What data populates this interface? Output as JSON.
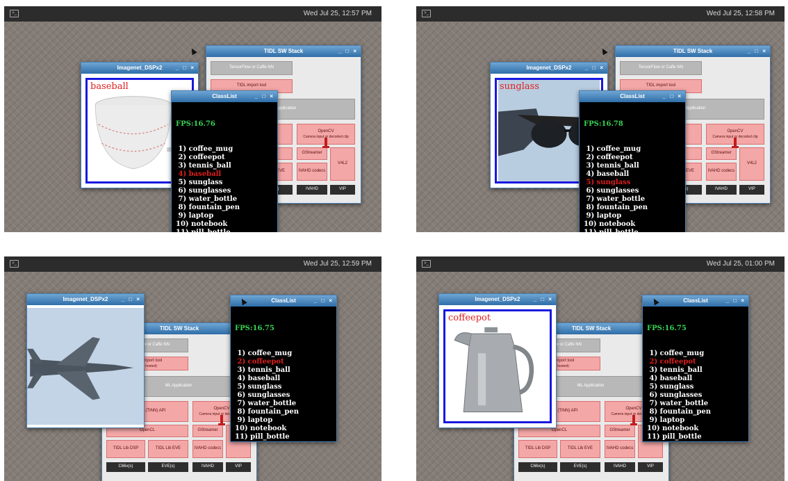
{
  "common": {
    "image_window_title": "Imagenet_DSPx2",
    "stack_window_title": "TIDL SW Stack",
    "classlist_title": "ClassList",
    "window_buttons": "_ □ ×",
    "stack_blocks": {
      "tensorflow": "TensorFlow or Caffe NN",
      "import_tool": "TIDL import tool",
      "import_tool_sub": "(x86 hosted)",
      "ml_application": "ML Application",
      "network": "Network (TINN) API",
      "opencv": "OpenCV",
      "opencv_sub": "Camera input or decoded clip",
      "opencl": "OpenCL",
      "gstreamer": "GStreamer",
      "lib_dsp": "TIDL Lib DSP",
      "lib_eve": "TIDL Lib EVE",
      "ivahd_codecs": "IVAHD codecs",
      "v4l2": "V4L2",
      "c66": "C66x(s)",
      "eve": "EVE(s)",
      "ivahd": "IVAHD",
      "vip": "VIP"
    }
  },
  "panels": [
    {
      "clock": "Wed Jul 25, 12:57 PM",
      "image_label": "baseball",
      "classlist_fps": "FPS:16.76",
      "classes": [
        {
          "num": "1)",
          "name": "coffee_mug"
        },
        {
          "num": "2)",
          "name": "coffeepot"
        },
        {
          "num": "3)",
          "name": "tennis_ball"
        },
        {
          "num": "4)",
          "name": "baseball"
        },
        {
          "num": "5)",
          "name": "sunglass"
        },
        {
          "num": "6)",
          "name": "sunglasses"
        },
        {
          "num": "7)",
          "name": "water_bottle"
        },
        {
          "num": "8)",
          "name": "fountain_pen"
        },
        {
          "num": "9)",
          "name": "laptop"
        },
        {
          "num": "10)",
          "name": "notebook"
        },
        {
          "num": "11)",
          "name": "pill_bottle"
        }
      ],
      "highlight_index": 3
    },
    {
      "clock": "Wed Jul 25, 12:58 PM",
      "image_label": "sunglass",
      "classlist_fps": "FPS:16.78",
      "classes": [
        {
          "num": "1)",
          "name": "coffee_mug"
        },
        {
          "num": "2)",
          "name": "coffeepot"
        },
        {
          "num": "3)",
          "name": "tennis_ball"
        },
        {
          "num": "4)",
          "name": "baseball"
        },
        {
          "num": "5)",
          "name": "sunglass"
        },
        {
          "num": "6)",
          "name": "sunglasses"
        },
        {
          "num": "7)",
          "name": "water_bottle"
        },
        {
          "num": "8)",
          "name": "fountain_pen"
        },
        {
          "num": "9)",
          "name": "laptop"
        },
        {
          "num": "10)",
          "name": "notebook"
        },
        {
          "num": "11)",
          "name": "pill_bottle"
        }
      ],
      "highlight_index": 4
    },
    {
      "clock": "Wed Jul 25, 12:59 PM",
      "image_label": "",
      "classlist_fps": "FPS:16.75",
      "classes": [
        {
          "num": "1)",
          "name": "coffee_mug"
        },
        {
          "num": "2)",
          "name": "coffeepot"
        },
        {
          "num": "3)",
          "name": "tennis_ball"
        },
        {
          "num": "4)",
          "name": "baseball"
        },
        {
          "num": "5)",
          "name": "sunglass"
        },
        {
          "num": "6)",
          "name": "sunglasses"
        },
        {
          "num": "7)",
          "name": "water_bottle"
        },
        {
          "num": "8)",
          "name": "fountain_pen"
        },
        {
          "num": "9)",
          "name": "laptop"
        },
        {
          "num": "10)",
          "name": "notebook"
        },
        {
          "num": "11)",
          "name": "pill_bottle"
        }
      ],
      "highlight_index": 1
    },
    {
      "clock": "Wed Jul 25, 01:00 PM",
      "image_label": "coffeepot",
      "classlist_fps": "FPS:16.75",
      "classes": [
        {
          "num": "1)",
          "name": "coffee_mug"
        },
        {
          "num": "2)",
          "name": "coffeepot"
        },
        {
          "num": "3)",
          "name": "tennis_ball"
        },
        {
          "num": "4)",
          "name": "baseball"
        },
        {
          "num": "5)",
          "name": "sunglass"
        },
        {
          "num": "6)",
          "name": "sunglasses"
        },
        {
          "num": "7)",
          "name": "water_bottle"
        },
        {
          "num": "8)",
          "name": "fountain_pen"
        },
        {
          "num": "9)",
          "name": "laptop"
        },
        {
          "num": "10)",
          "name": "notebook"
        },
        {
          "num": "11)",
          "name": "pill_bottle"
        }
      ],
      "highlight_index": 1
    }
  ],
  "colors": {
    "highlight": "#e01e1e",
    "fps": "#39d353",
    "frame": "#1818e0",
    "titlebar": "#2f6ea8"
  }
}
